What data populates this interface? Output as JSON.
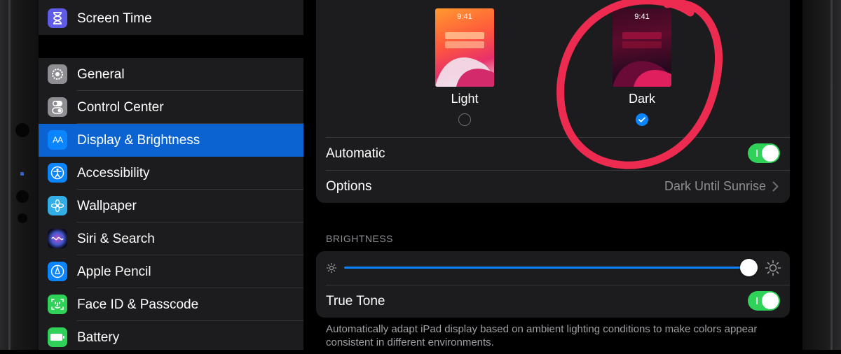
{
  "sidebar": {
    "top_item": {
      "label": "Screen Time",
      "icon": "hourglass-icon",
      "color": "#5e5ce6"
    },
    "items": [
      {
        "label": "General",
        "icon": "gear-icon",
        "color": "#8e8e93"
      },
      {
        "label": "Control Center",
        "icon": "switches-icon",
        "color": "#8e8e93"
      },
      {
        "label": "Display & Brightness",
        "icon": "text-size-icon",
        "color": "#0a84ff",
        "glyph": "AA",
        "selected": true
      },
      {
        "label": "Accessibility",
        "icon": "accessibility-icon",
        "color": "#0a84ff"
      },
      {
        "label": "Wallpaper",
        "icon": "flower-icon",
        "color": "#32ade6"
      },
      {
        "label": "Siri & Search",
        "icon": "siri-icon",
        "color": "#1c1c1e"
      },
      {
        "label": "Apple Pencil",
        "icon": "pencil-icon",
        "color": "#0a84ff"
      },
      {
        "label": "Face ID & Passcode",
        "icon": "face-id-icon",
        "color": "#30d158"
      },
      {
        "label": "Battery",
        "icon": "battery-icon",
        "color": "#30d158"
      }
    ]
  },
  "appearance": {
    "light": {
      "label": "Light",
      "time": "9:41",
      "selected": false
    },
    "dark": {
      "label": "Dark",
      "time": "9:41",
      "selected": true
    }
  },
  "automatic": {
    "label": "Automatic",
    "enabled": true
  },
  "options": {
    "label": "Options",
    "value": "Dark Until Sunrise"
  },
  "brightness": {
    "header": "BRIGHTNESS",
    "level": 0.99,
    "true_tone": {
      "label": "True Tone",
      "enabled": true
    },
    "footer": "Automatically adapt iPad display based on ambient lighting conditions to make colors appear consistent in different environments."
  },
  "colors": {
    "accent": "#0a84ff",
    "toggle_on": "#30d158",
    "annotation": "#ff2d55"
  }
}
